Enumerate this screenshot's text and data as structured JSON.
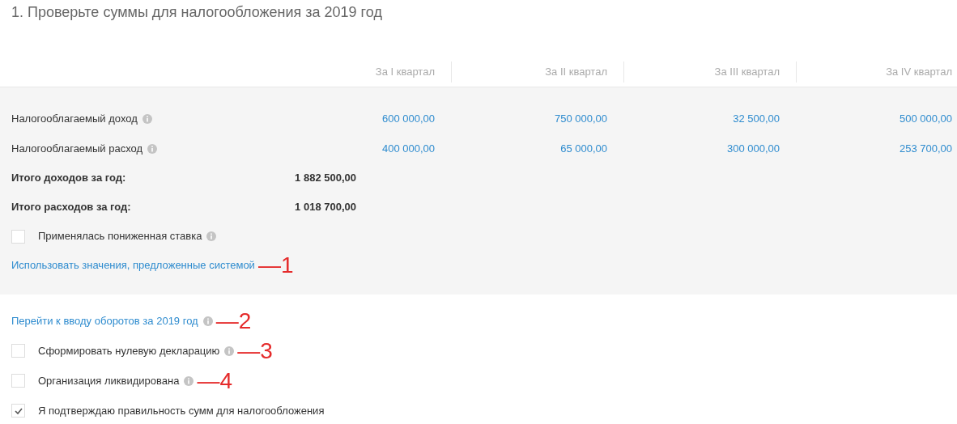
{
  "title": "1. Проверьте суммы для налогообложения за 2019 год",
  "columns": [
    "За I квартал",
    "За II квартал",
    "За III квартал",
    "За IV квартал"
  ],
  "rows": [
    {
      "label": "Налогооблагаемый доход",
      "values": [
        "600 000,00",
        "750 000,00",
        "32 500,00",
        "500 000,00"
      ]
    },
    {
      "label": "Налогооблагаемый расход",
      "values": [
        "400 000,00",
        "65 000,00",
        "300 000,00",
        "253 700,00"
      ]
    }
  ],
  "totals": [
    {
      "label": "Итого доходов за год:",
      "value": "1 882 500,00"
    },
    {
      "label": "Итого расходов за год:",
      "value": "1 018 700,00"
    }
  ],
  "panel_items": [
    {
      "kind": "checkbox",
      "label": "Применялась пониженная ставка",
      "checked": false,
      "info": true
    },
    {
      "kind": "link",
      "label": "Использовать значения, предложенные системой",
      "info": false,
      "annotation": "—1"
    }
  ],
  "options": [
    {
      "kind": "link",
      "label": "Перейти к вводу оборотов за 2019 год",
      "info": true,
      "annotation": "—2"
    },
    {
      "kind": "checkbox",
      "label": "Сформировать нулевую декларацию",
      "checked": false,
      "info": true,
      "annotation": "—3"
    },
    {
      "kind": "checkbox",
      "label": "Организация ликвидирована",
      "checked": false,
      "info": true,
      "annotation": "—4"
    },
    {
      "kind": "checkbox",
      "label": "Я подтверждаю правильность сумм для налогообложения",
      "checked": true,
      "info": false
    }
  ]
}
